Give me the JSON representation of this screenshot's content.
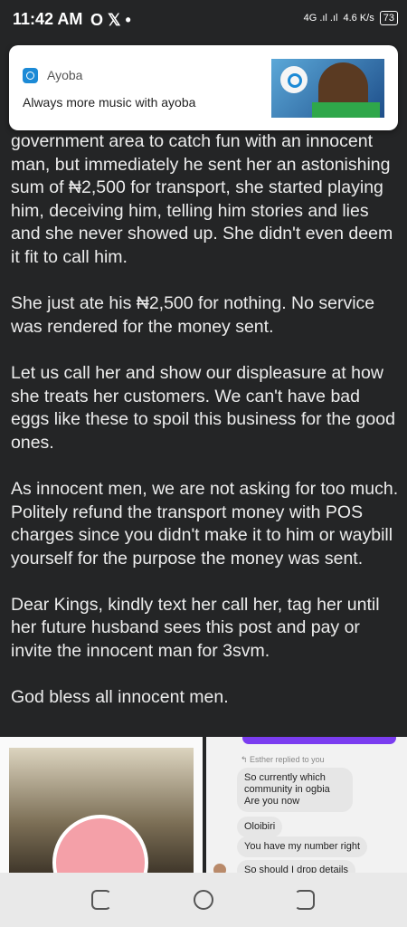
{
  "status_bar": {
    "time": "11:42 AM",
    "icons": "O 𝕏 •",
    "network": "4G .ıl .ıl",
    "speed": "4.6 K/s",
    "battery": "73"
  },
  "notification": {
    "app_name": "Ayoba",
    "message": "Always more music with ayoba"
  },
  "post": {
    "paragraphs": [
      "government area to catch fun with an innocent man, but immediately he sent her an astonishing sum of ₦2,500 for transport, she started playing him, deceiving him, telling him stories and lies and she never showed up. She didn't even deem it fit to call him.",
      "She just ate his ₦2,500 for nothing. No service was rendered for the money sent.",
      "Let us call her and show our displeasure at how she treats her customers. We can't have bad eggs like these to spoil this business for the good ones.",
      "As innocent men, we are not asking for too much. Politely refund the transport money with POS charges since you didn't make it to him or waybill yourself for the purpose the money was sent.",
      "Dear Kings, kindly text her call her, tag her until her future husband sees this post and pay or invite the innocent man for 3svm.",
      "God bless all innocent men."
    ]
  },
  "chat": {
    "reply_note": "↰ Esther replied to you",
    "messages": [
      "So currently which community in ogbia Are you now",
      "Oloibiri",
      "You have my number right",
      "So should I drop details"
    ]
  }
}
